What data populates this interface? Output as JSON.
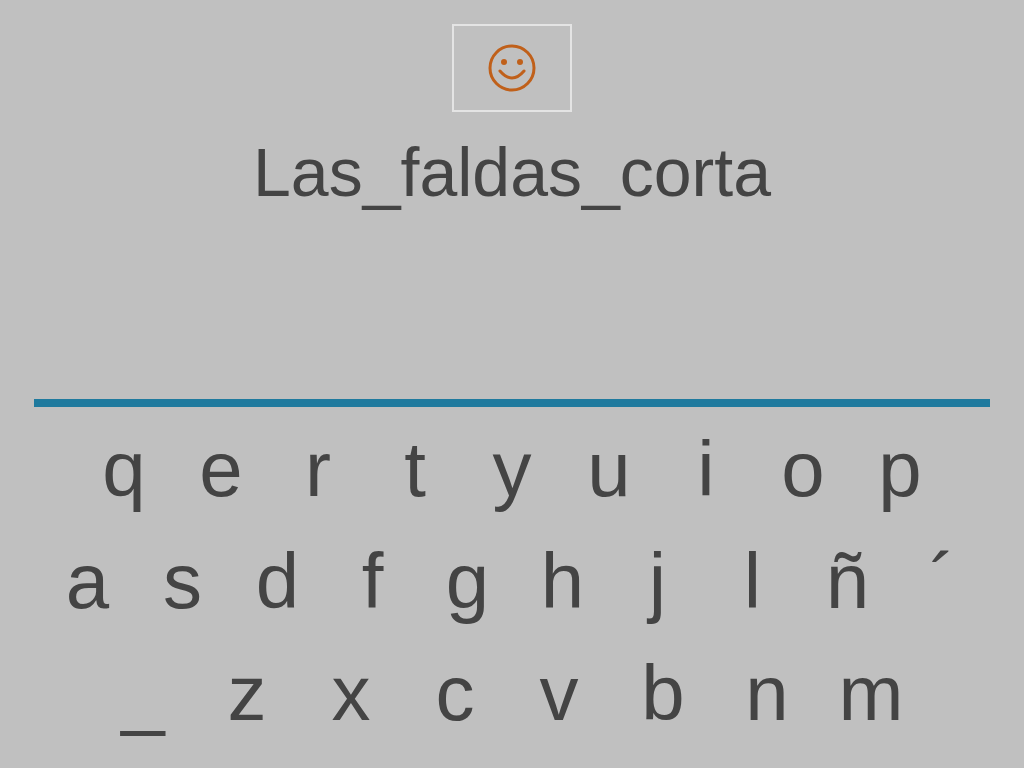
{
  "phrase": "Las_faldas_corta",
  "keyboard": [
    [
      "q",
      "e",
      "r",
      "t",
      "y",
      "u",
      "i",
      "o",
      "p"
    ],
    [
      "a",
      "s",
      "d",
      "f",
      "g",
      "h",
      "j",
      "l",
      "ñ",
      "´"
    ],
    [
      "_",
      "z",
      "x",
      "c",
      "v",
      "b",
      "n",
      "m"
    ]
  ]
}
